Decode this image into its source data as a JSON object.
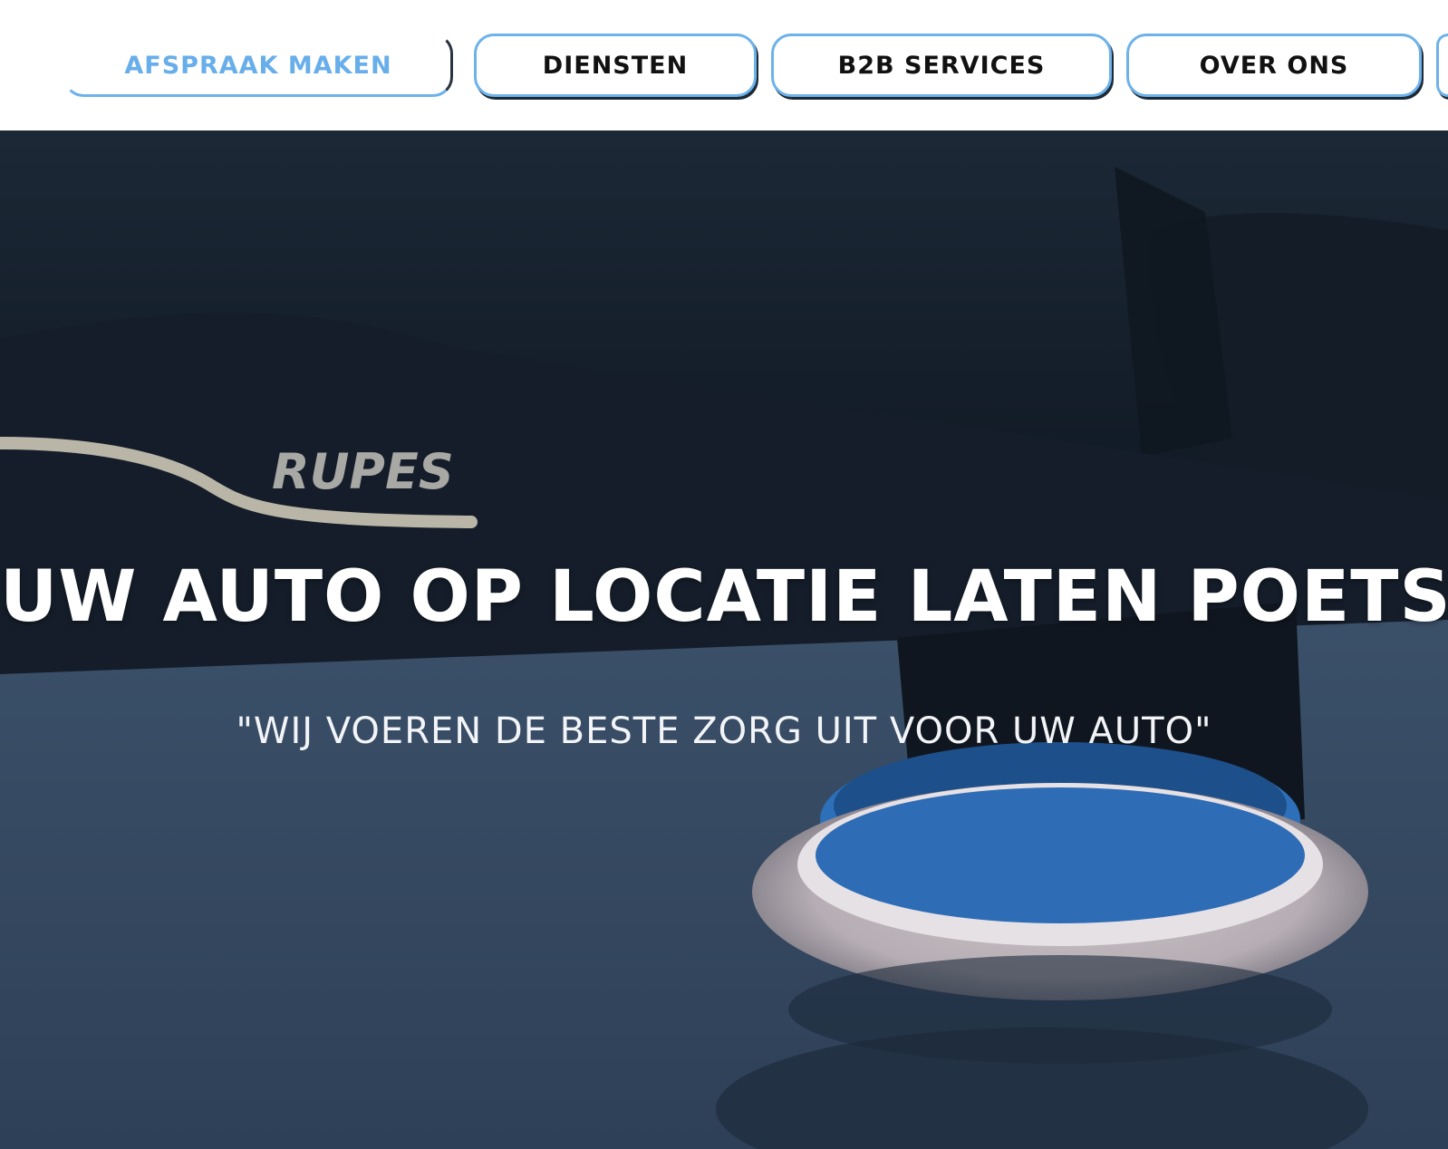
{
  "nav": {
    "items": [
      {
        "label": "AFSPRAAK MAKEN",
        "active": true
      },
      {
        "label": "DIENSTEN",
        "active": false
      },
      {
        "label": "B2B SERVICES",
        "active": false
      },
      {
        "label": "OVER ONS",
        "active": false
      }
    ]
  },
  "hero": {
    "title": "UW AUTO OP LOCATIE LATEN POETSEN",
    "subtitle": "\"WIJ VOEREN DE BESTE ZORG UIT VOOR UW AUTO\"",
    "image_text": "RUPES",
    "image_subject": "rotary-polisher-on-car-hood"
  },
  "colors": {
    "accent": "#6db2ea",
    "active_text": "#67aeea",
    "nav_text": "#111111",
    "hero_text": "#ffffff"
  }
}
